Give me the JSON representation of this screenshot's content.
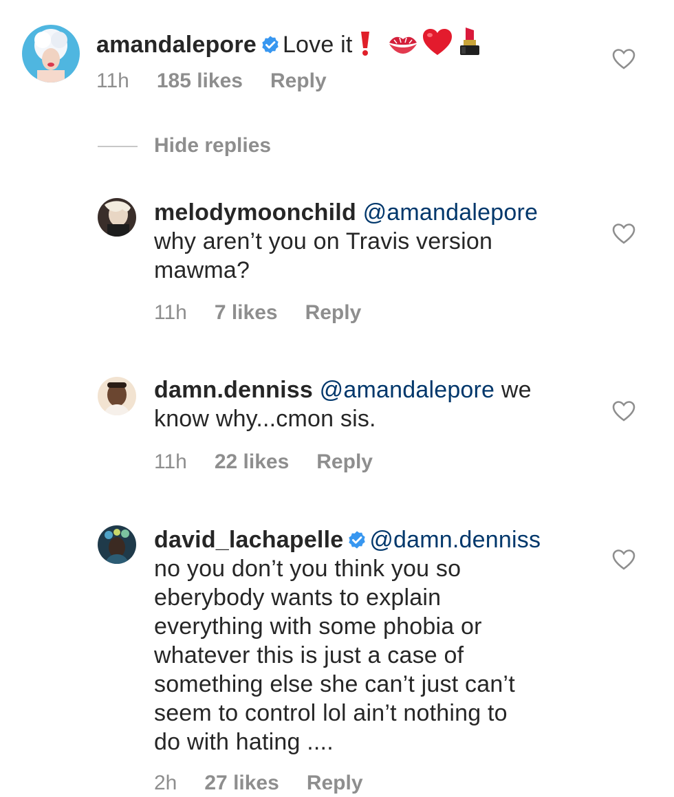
{
  "comments": [
    {
      "username": "amandalepore",
      "verified": true,
      "text": "Love it",
      "emoji_names": [
        "red-exclamation-icon",
        "kiss-mark-icon",
        "red-heart-icon",
        "lipstick-icon"
      ],
      "time": "11h",
      "likes": "185 likes",
      "reply": "Reply"
    }
  ],
  "thread": {
    "hide_replies": "Hide replies"
  },
  "replies": [
    {
      "username": "melodymoonchild",
      "mention": "@amandalepore",
      "line1": "why aren’t you on Travis version",
      "line2": "mawma?",
      "time": "11h",
      "likes": "7 likes",
      "reply": "Reply"
    },
    {
      "username": "damn.denniss",
      "mention": "@amandalepore",
      "tail": "we",
      "line2": "know why...cmon sis.",
      "time": "11h",
      "likes": "22 likes",
      "reply": "Reply"
    },
    {
      "username": "david_lachapelle",
      "verified": true,
      "mention": "@damn.denniss",
      "lines": [
        "no you don’t you think you so",
        "eberybody wants to explain",
        "everything with some phobia or",
        "whatever this is just a case of",
        "something else she can’t just can’t",
        "seem to control lol ain’t nothing to",
        "do with hating ...."
      ],
      "time": "2h",
      "likes": "27 likes",
      "reply": "Reply"
    }
  ],
  "colors": {
    "text": "#262626",
    "mention": "#00376b",
    "meta": "#8e8e8e",
    "verified": "#3897f0"
  }
}
